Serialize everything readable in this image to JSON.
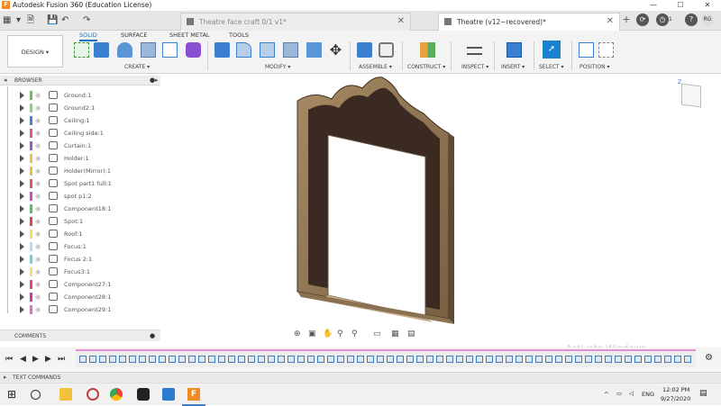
{
  "window": {
    "app_title": "Autodesk Fusion 360 (Education License)",
    "minimize": "—",
    "maximize": "☐",
    "close": "✕"
  },
  "tabs": [
    {
      "label": "Theatre face craft 0/1 v1*",
      "active": false
    },
    {
      "label": "Theatre (v12~recovered)*",
      "active": true
    }
  ],
  "tabbar_right": {
    "plus": "+",
    "notif_count": "1",
    "user_initials": "RG"
  },
  "ribbon": {
    "workspace": "DESIGN",
    "tabs": [
      "SOLID",
      "SURFACE",
      "SHEET METAL",
      "TOOLS"
    ],
    "groups": [
      "CREATE",
      "MODIFY",
      "ASSEMBLE",
      "CONSTRUCT",
      "INSPECT",
      "INSERT",
      "SELECT",
      "POSITION"
    ]
  },
  "browser": {
    "header": "BROWSER",
    "items": [
      {
        "label": "Ground:1",
        "color": "#6cc04a"
      },
      {
        "label": "Ground2:1",
        "color": "#8fd36a"
      },
      {
        "label": "Ceiling:1",
        "color": "#3a87e0"
      },
      {
        "label": "Ceiling side:1",
        "color": "#e0568a"
      },
      {
        "label": "Curtain:1",
        "color": "#9b59d0"
      },
      {
        "label": "Holder:1",
        "color": "#f0c040"
      },
      {
        "label": "Holder(Mirror):1",
        "color": "#f0c040"
      },
      {
        "label": "Spot part1 full:1",
        "color": "#e05a5a"
      },
      {
        "label": "spot p1:2",
        "color": "#cc4fc8"
      },
      {
        "label": "Component18:1",
        "color": "#4fbf60"
      },
      {
        "label": "Spot:1",
        "color": "#e04848"
      },
      {
        "label": "Roof:1",
        "color": "#f2df5a"
      },
      {
        "label": "Focus:1",
        "color": "#b0e0f0"
      },
      {
        "label": "Focus 2:1",
        "color": "#6fd0e0"
      },
      {
        "label": "Focus3:1",
        "color": "#f0e070"
      },
      {
        "label": "Component27:1",
        "color": "#e04870"
      },
      {
        "label": "Component28:1",
        "color": "#cc3aa0"
      },
      {
        "label": "Component29:1",
        "color": "#e070c0"
      }
    ]
  },
  "comments": {
    "label": "COMMENTS"
  },
  "text_commands": {
    "label": "TEXT COMMANDS"
  },
  "watermark": "Activate Windows",
  "taskbar": {
    "language": "ENG",
    "time": "12:02 PM",
    "date": "9/27/2020"
  }
}
